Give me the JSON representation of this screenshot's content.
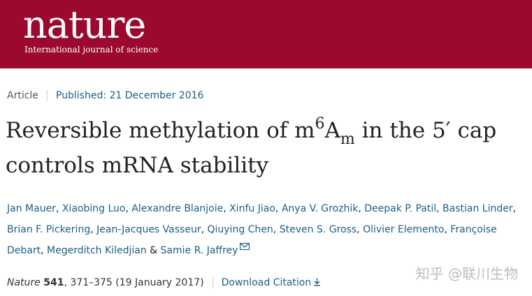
{
  "header": {
    "logo_text": "nature",
    "tagline": "International journal of science",
    "brand_color": "#9b0a2e"
  },
  "article_meta": {
    "type": "Article",
    "published": "Published: 21 December 2016"
  },
  "title": {
    "before": "Reversible methylation of m",
    "superscript": "6",
    "middle": "A",
    "subscript": "m",
    "after": " in the 5′ cap controls mRNA stability"
  },
  "authors": [
    "Jan Mauer",
    "Xiaobing Luo",
    "Alexandre Blanjoie",
    "Xinfu Jiao",
    "Anya V. Grozhik",
    "Deepak P. Patil",
    "Bastian Linder",
    "Brian F. Pickering",
    "Jean-Jacques Vasseur",
    "Qiuying Chen",
    "Steven S. Gross",
    "Olivier Elemento",
    "Françoise Debart",
    "Megerditch Kiledjian",
    "Samie R. Jaffrey"
  ],
  "authors_conjunction": "&",
  "contact_icon": "mail-icon",
  "citation": {
    "journal": "Nature",
    "volume": "541",
    "pages": ", 371–375 (19 January 2017)",
    "download_label": "Download Citation",
    "download_icon": "download-icon"
  },
  "watermark": "知乎 @联川生物",
  "link_color": "#1b5e86"
}
